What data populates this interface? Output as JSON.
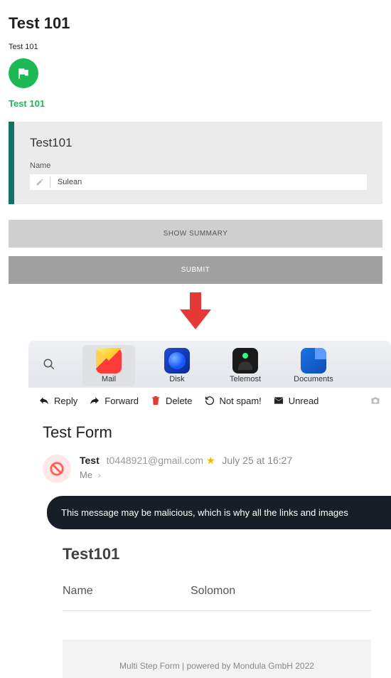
{
  "form": {
    "title": "Test 101",
    "subtitle": "Test 101",
    "step_label": "Test 101",
    "panel_title": "Test101",
    "name_label": "Name",
    "name_value": "Sulean",
    "summary_btn": "SHOW SUMMARY",
    "submit_btn": "SUBMIT"
  },
  "apps": {
    "mail": "Mail",
    "disk": "Disk",
    "telemost": "Telemost",
    "documents": "Documents"
  },
  "toolbar": {
    "reply": "Reply",
    "forward": "Forward",
    "delete": "Delete",
    "notspam": "Not spam!",
    "unread": "Unread"
  },
  "email": {
    "subject": "Test Form",
    "sender_name": "Test",
    "sender_addr": "t0448921@gmail.com",
    "date": "July 25 at 16:27",
    "recipient": "Me",
    "warning": "This message may be malicious, which is why all the links and images",
    "submission": {
      "title": "Test101",
      "name_label": "Name",
      "name_value": "Solomon"
    },
    "footer": "Multi Step Form | powered by Mondula GmbH 2022"
  }
}
